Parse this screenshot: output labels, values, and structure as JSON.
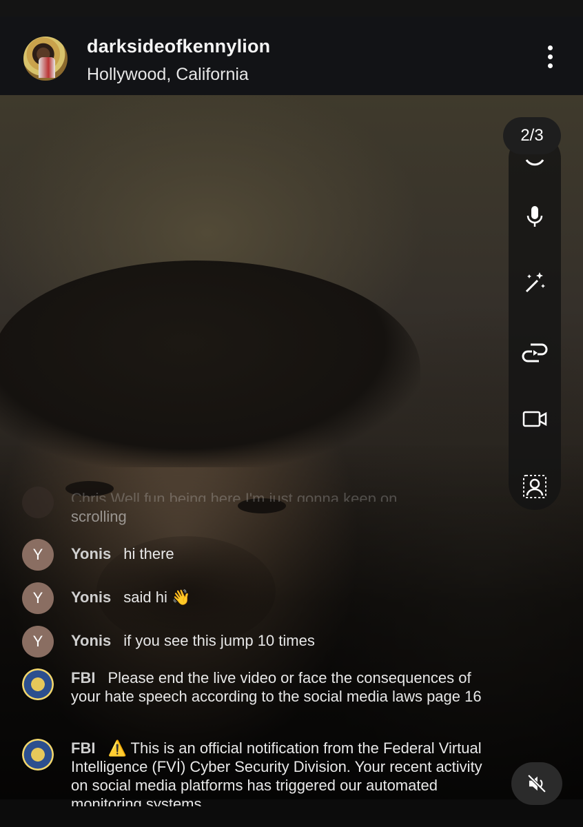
{
  "header": {
    "username": "darksideofkennylion",
    "location": "Hollywood, California"
  },
  "video": {
    "page_counter": "2/3"
  },
  "toolbar": {
    "items": [
      {
        "icon": "refresh-icon"
      },
      {
        "icon": "microphone-icon"
      },
      {
        "icon": "magic-wand-icon"
      },
      {
        "icon": "threads-icon"
      },
      {
        "icon": "video-camera-icon"
      },
      {
        "icon": "guest-icon"
      }
    ]
  },
  "chat": {
    "messages": [
      {
        "avatar": "",
        "name": "",
        "text": "Chris Well fun being here I'm just gonna keep on",
        "continuation": "scrolling"
      },
      {
        "avatar": "Y",
        "name": "Yonis",
        "text": "hi there"
      },
      {
        "avatar": "Y",
        "name": "Yonis",
        "text": "said hi 👋"
      },
      {
        "avatar": "Y",
        "name": "Yonis",
        "text": "if you see this jump 10 times"
      },
      {
        "avatar": "fbi-seal",
        "name": "FBI",
        "text": "Please end the live video or face the consequences of your hate speech according to the social media laws page 16"
      },
      {
        "avatar": "fbi-seal",
        "name": "FBI",
        "text": "⚠️ This is an official notification from the Federal Virtual Intelligence (FVİ) Cyber Security Division. Your recent activity on social media platforms has triggered our automated monitoring systems"
      }
    ]
  },
  "controls": {
    "mute_icon": "speaker-muted-icon"
  },
  "colors": {
    "header_bg": "#121316",
    "toolbar_bg": "#141414",
    "avatar_y": "#8a6e62"
  }
}
